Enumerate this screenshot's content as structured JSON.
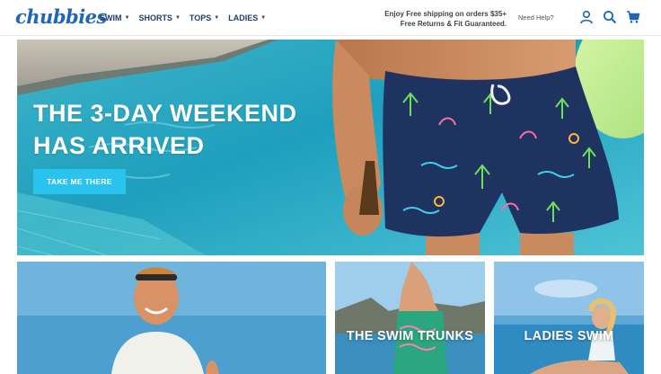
{
  "header": {
    "logo": "chubbies",
    "nav": [
      {
        "label": "SWIM",
        "name": "nav-swim"
      },
      {
        "label": "SHORTS",
        "name": "nav-shorts"
      },
      {
        "label": "TOPS",
        "name": "nav-tops"
      },
      {
        "label": "LADIES",
        "name": "nav-ladies"
      }
    ],
    "promo_line1": "Enjoy Free shipping on orders $35+",
    "promo_line2": "Free Returns & Fit Guaranteed.",
    "help": "Need Help?",
    "icons": [
      "user-icon",
      "search-icon",
      "cart-icon"
    ]
  },
  "hero": {
    "title_line1": "THE 3-DAY WEEKEND",
    "title_line2": "HAS ARRIVED",
    "cta": "TAKE ME THERE"
  },
  "cards": [
    {
      "label": ""
    },
    {
      "label": "THE SWIM TRUNKS"
    },
    {
      "label": "LADIES SWIM"
    }
  ],
  "colors": {
    "brand": "#1d66b8",
    "nav_text": "#1f3f6e",
    "cta": "#29c3ee"
  }
}
